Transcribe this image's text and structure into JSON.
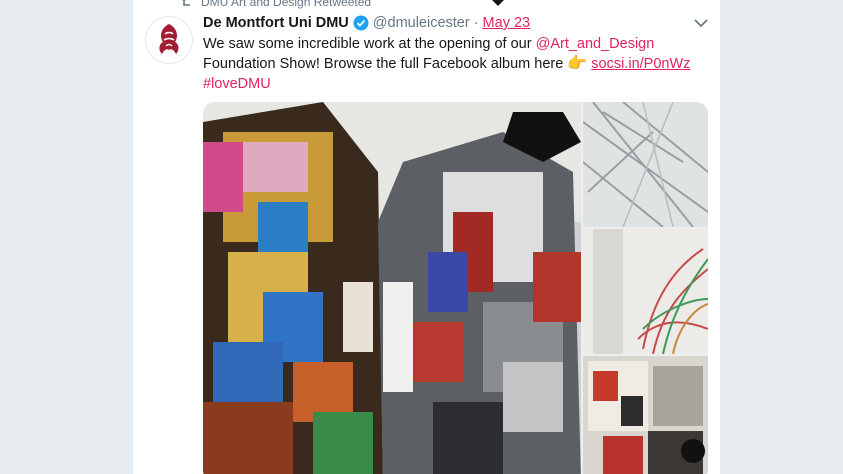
{
  "retweet_context": "DMU Art and Design Retweeted",
  "tweet": {
    "display_name": "De Montfort Uni DMU",
    "screen_name": "@dmuleicester",
    "separator": "·",
    "timestamp": "May 23",
    "text_1": "We saw some incredible work at the opening of our ",
    "mention": "@Art_and_Design",
    "text_2": "Foundation Show! Browse the full Facebook album here ",
    "emoji": "👉",
    "link": "socsi.in/P0nWz",
    "hashtag": "#loveDMU"
  },
  "colors": {
    "accent": "#e0245e",
    "secondary_text": "#657786",
    "verified": "#1da1f2"
  },
  "icons": {
    "retweet": "retweet-icon",
    "verified": "verified-badge-icon",
    "caret": "chevron-down-icon",
    "emoji": "backhand-index-pointing-right-icon"
  }
}
